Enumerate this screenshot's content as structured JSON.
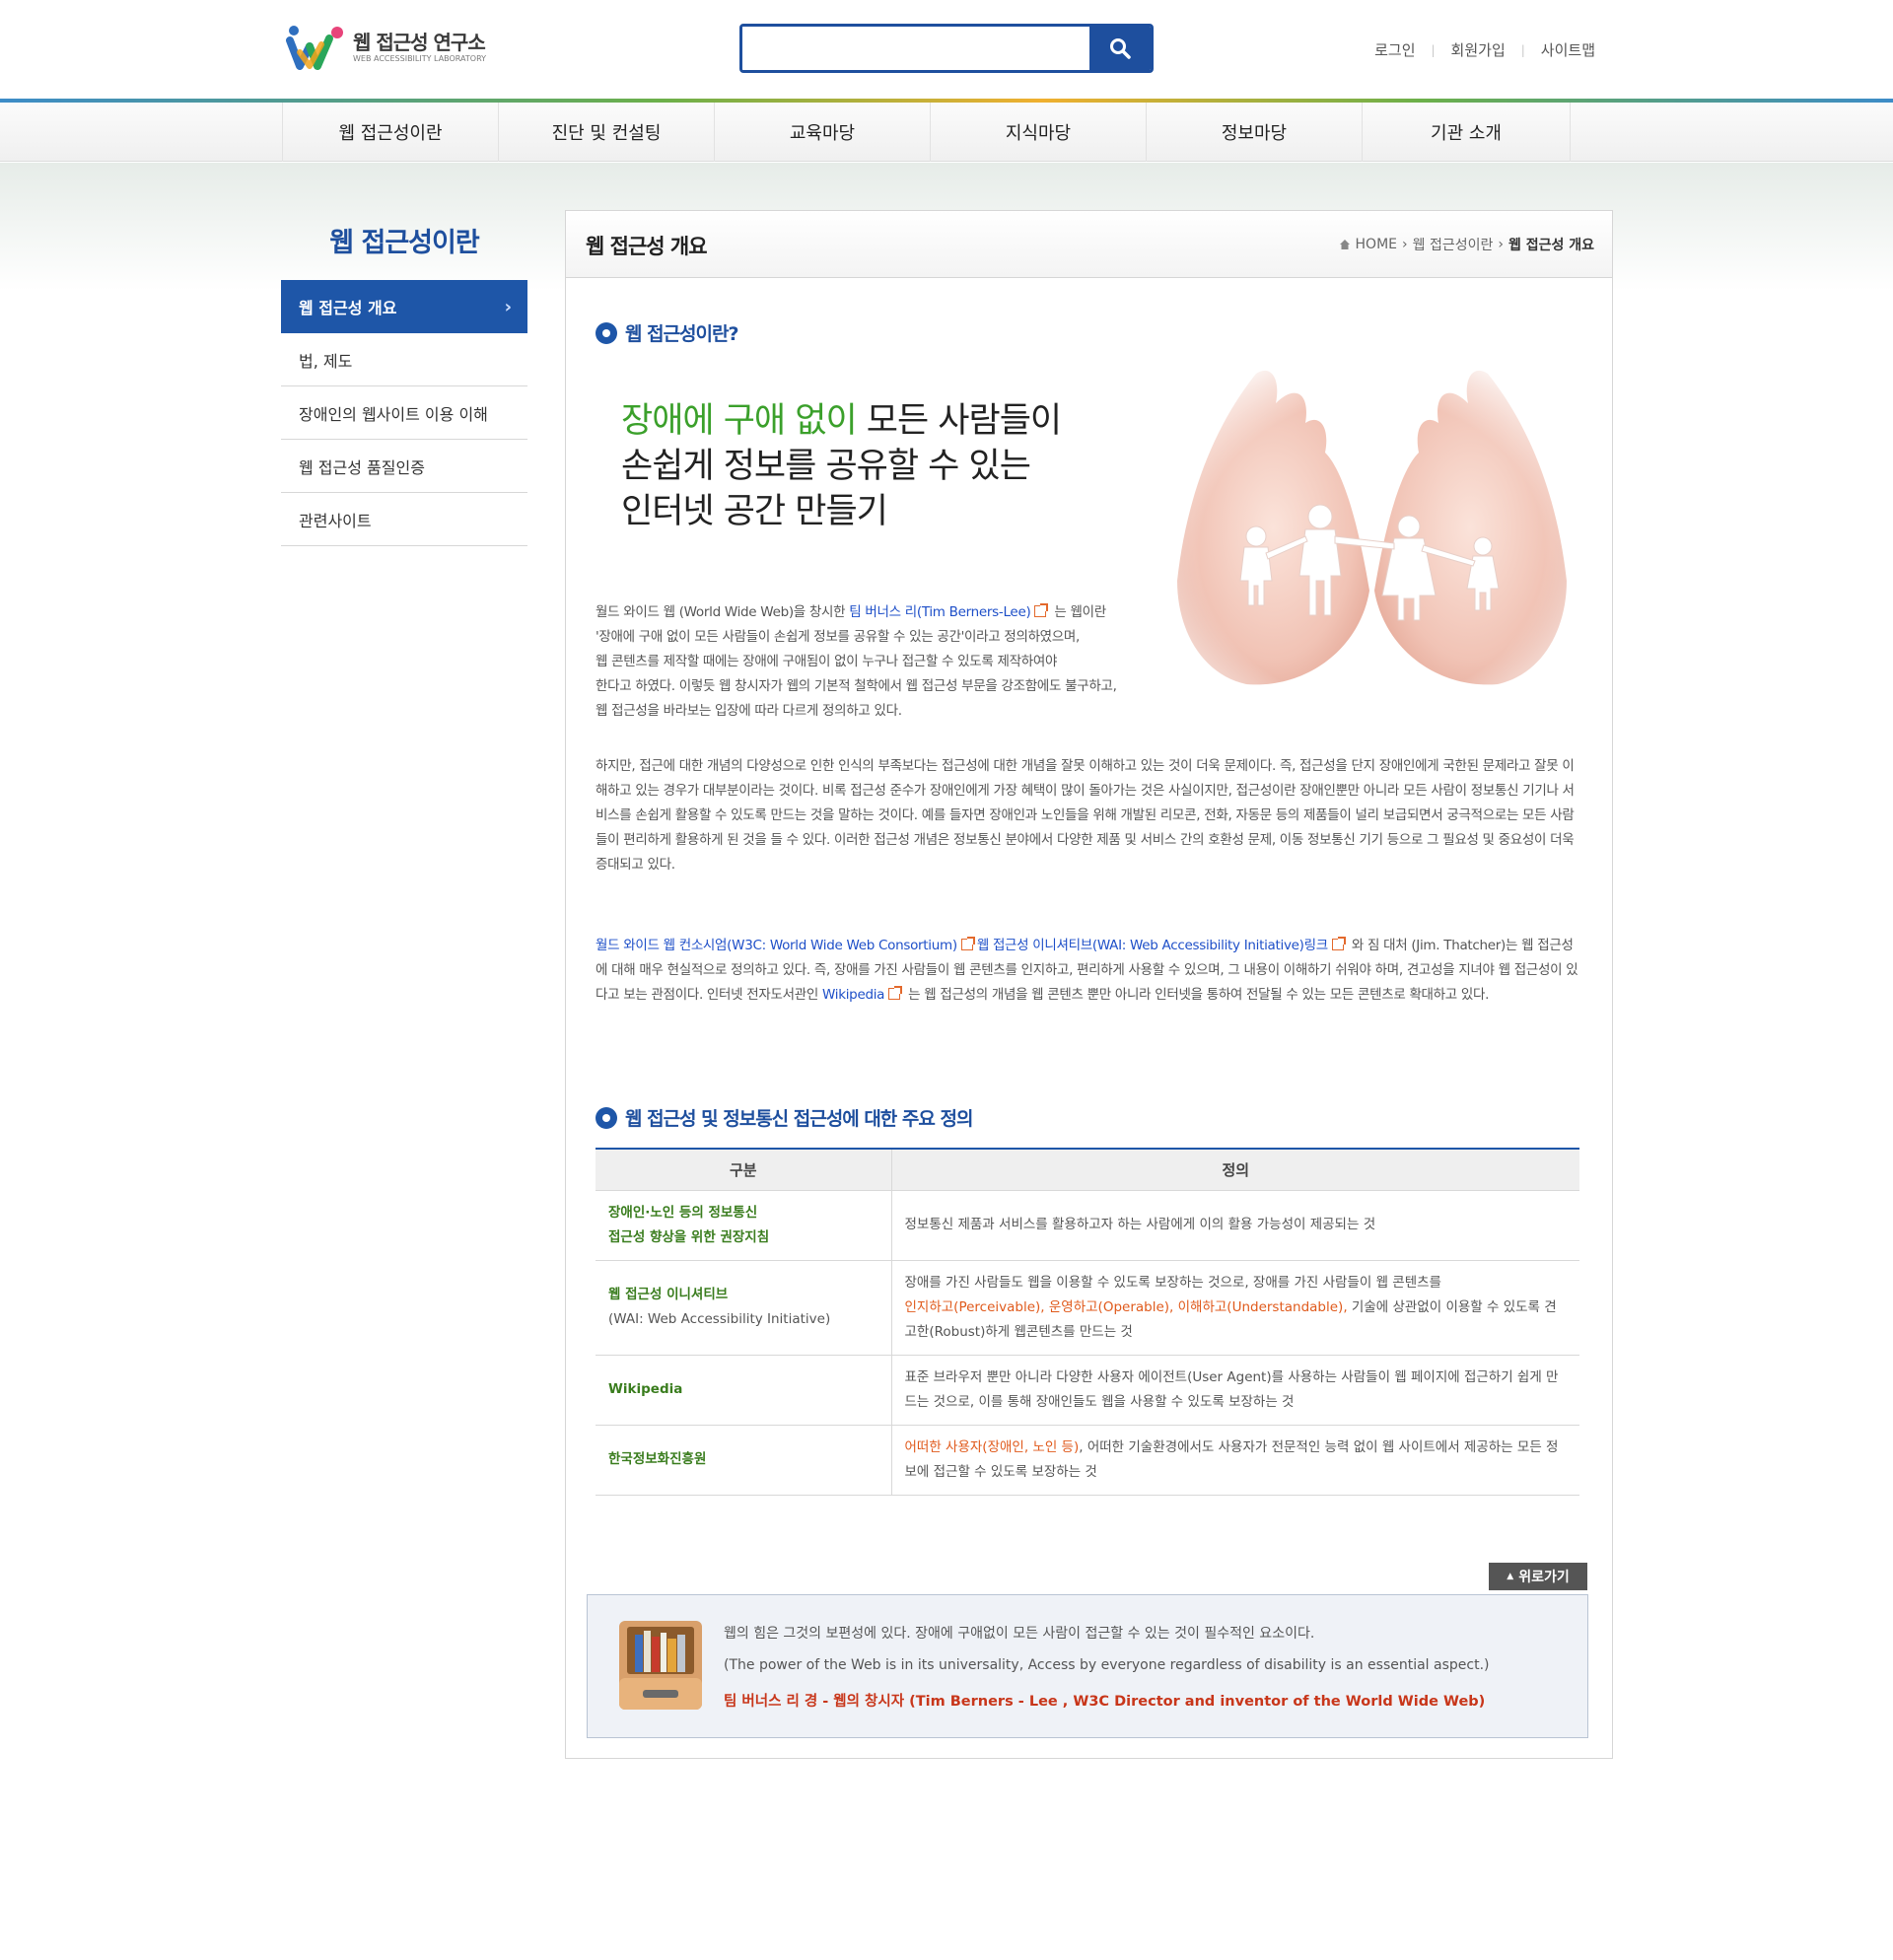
{
  "header": {
    "logo_title": "웹 접근성 연구소",
    "logo_sub": "WEB ACCESSIBILITY LABORATORY",
    "search_placeholder": "",
    "util_links": [
      "로그인",
      "회원가입",
      "사이트맵"
    ]
  },
  "gnb": [
    "웹 접근성이란",
    "진단 및 컨설팅",
    "교육마당",
    "지식마당",
    "정보마당",
    "기관 소개"
  ],
  "lnb": {
    "title": "웹 접근성이란",
    "items": [
      "웹 접근성 개요",
      "법, 제도",
      "장애인의 웹사이트 이용 이해",
      "웹 접근성 품질인증",
      "관련사이트"
    ]
  },
  "content": {
    "page_title": "웹 접근성 개요",
    "breadcrumb": [
      "HOME",
      "웹 접근성이란",
      "웹 접근성 개요"
    ],
    "section1_title": "웹 접근성이란?",
    "slogan_green": "장애에 구애 없이",
    "slogan_rest1": " 모든 사람들이",
    "slogan_line2": "손쉽게 정보를 공유할 수 있는",
    "slogan_line3": "인터넷 공간 만들기",
    "p1_a": "월드 와이드 웹 (World Wide Web)을 창시한 ",
    "p1_link": "팀 버너스 리(Tim Berners-Lee)",
    "p1_b": " 는 웹이란",
    "p1_l2": "'장애에 구애 없이 모든 사람들이 손쉽게 정보를 공유할 수 있는 공간'이라고 정의하였으며,",
    "p1_l3": "웹 콘텐츠를 제작할 때에는 장애에 구애됨이 없이 누구나 접근할 수 있도록 제작하여야",
    "p1_l4": "한다고 하였다. 이렇듯 웹 창시자가 웹의 기본적 철학에서 웹 접근성 부문을 강조함에도 불구하고,",
    "p1_l5": "웹 접근성을 바라보는 입장에 따라 다르게 정의하고 있다.",
    "p2": "하지만, 접근에 대한 개념의 다양성으로 인한 인식의 부족보다는 접근성에 대한 개념을 잘못 이해하고 있는 것이 더욱 문제이다. 즉, 접근성을 단지 장애인에게 국한된 문제라고 잘못 이해하고 있는 경우가 대부분이라는 것이다. 비록 접근성 준수가 장애인에게 가장 혜택이 많이 돌아가는 것은 사실이지만, 접근성이란 장애인뿐만 아니라 모든 사람이 정보통신 기기나 서비스를 손쉽게 활용할 수 있도록 만드는 것을 말하는 것이다. 예를 들자면 장애인과 노인들을 위해 개발된 리모콘, 전화, 자동문 등의 제품들이 널리 보급되면서 궁극적으로는 모든 사람들이 편리하게 활용하게 된 것을 들 수 있다. 이러한 접근성 개념은 정보통신 분야에서 다양한 제품 및 서비스 간의 호환성 문제, 이동 정보통신 기기 등으로 그 필요성 및 중요성이 더욱 증대되고 있다.",
    "p3_link1": "월드 와이드 웹 컨소시엄(W3C: World Wide Web Consortium)",
    "p3_link2": "웹 접근성 이니셔티브(WAI: Web Accessibility Initiative)링크",
    "p3_a": " 와 짐 대처 (Jim. Thatcher)는 웹 접근성에 대해 매우 현실적으로 정의하고 있다. 즉, 장애를 가진 사람들이 웹 콘텐츠를 인지하고, 편리하게 사용할 수 있으며, 그 내용이 이해하기 쉬워야 하며, 견고성을 지녀야 웹 접근성이 있다고 보는 관점이다. 인터넷 전자도서관인 ",
    "p3_link3": "Wikipedia",
    "p3_b": " 는 웹 접근성의 개념을 웹 콘텐츠 뿐만 아니라 인터넷을 통하여 전달될 수 있는 모든 콘텐츠로 확대하고 있다.",
    "section2_title": "웹 접근성 및 정보통신 접근성에 대한 주요 정의",
    "table": {
      "headers": [
        "구분",
        "정의"
      ],
      "rows": [
        {
          "term": "장애인·노인 등의 정보통신",
          "term2": "접근성 향상을 위한 권장지침",
          "def": "정보통신 제품과 서비스를 활용하고자 하는 사람에게 이의 활용 가능성이 제공되는 것"
        },
        {
          "term": "웹 접근성 이니셔티브",
          "term_sub": "(WAI: Web Accessibility Initiative)",
          "def_a": "장애를 가진 사람들도 웹을 이용할 수 있도록 보장하는 것으로, 장애를 가진 사람들이 웹 콘텐츠를",
          "def_orange": "인지하고(Perceivable), 운영하고(Operable), 이해하고(Understandable),",
          "def_b": " 기술에 상관없이 이용할 수 있도록 견고한(Robust)하게 웹콘텐츠를 만드는 것"
        },
        {
          "term": "Wikipedia",
          "def": "표준 브라우저 뿐만 아니라 다양한 사용자 에이전트(User Agent)를 사용하는 사람들이 웹 페이지에 접근하기 쉽게 만드는 것으로, 이를 통해 장애인들도 웹을 사용할 수 있도록 보장하는 것"
        },
        {
          "term": "한국정보화진흥원",
          "def_orange": "어떠한 사용자(장애인, 노인 등)",
          "def_b": ", 어떠한 기술환경에서도 사용자가 전문적인 능력 없이 웹 사이트에서 제공하는 모든 정보에 접근할 수 있도록 보장하는 것"
        }
      ]
    },
    "top_button": "위로가기",
    "quote_ko": "웹의 힘은 그것의 보편성에 있다. 장애에 구애없이 모든 사람이 접근할 수 있는 것이 필수적인 요소이다.",
    "quote_en": "(The power of the Web is in its universality, Access by everyone regardless of disability is an essential aspect.)",
    "quote_author": "팀 버너스 리 경 - 웹의 창시자 (Tim Berners - Lee , W3C Director and inventor of the World Wide Web)"
  },
  "colors": {
    "brand_blue": "#1e4f9e",
    "green": "#3ba02b",
    "orange": "#e05a1c"
  }
}
